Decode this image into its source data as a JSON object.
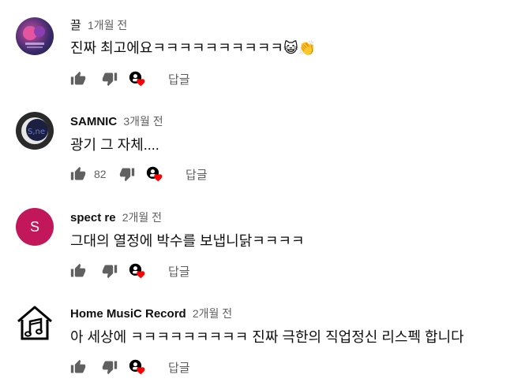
{
  "comments": [
    {
      "author": "끌",
      "time": "1개월 전",
      "text": "진짜 최고에요ㅋㅋㅋㅋㅋㅋㅋㅋㅋㅋ",
      "emojis": "😺👏",
      "like_count": "",
      "reply_label": "답글",
      "avatar": "image"
    },
    {
      "author": "SAMNIC",
      "time": "3개월 전",
      "text": "광기 그 자체....",
      "like_count": "82",
      "reply_label": "답글",
      "avatar": "image"
    },
    {
      "author": "spect re",
      "time": "2개월 전",
      "text": "그대의 열정에 박수를 보냅니닭ㅋㅋㅋㅋ",
      "like_count": "",
      "reply_label": "답글",
      "avatar": "letter",
      "avatar_letter": "S",
      "avatar_color": "#c2185b"
    },
    {
      "author": "Home MusiC Record",
      "time": "2개월 전",
      "text": "아 세상에 ㅋㅋㅋㅋㅋㅋㅋㅋㅋ 진짜 극한의 직업정신 리스펙 합니다",
      "like_count": "",
      "reply_label": "답글",
      "avatar": "house-music-logo"
    }
  ],
  "icons": {
    "like": "thumb-up-icon",
    "dislike": "thumb-down-icon",
    "creator_heart": "creator-heart-icon"
  },
  "colors": {
    "heart": "#ff0000",
    "secondary_text": "#606060"
  }
}
